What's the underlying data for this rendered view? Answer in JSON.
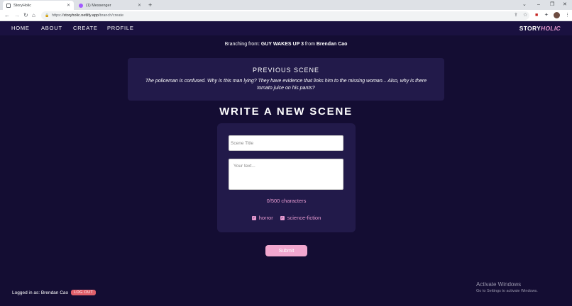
{
  "browser": {
    "tabs": [
      {
        "title": "StoryHolic",
        "active": true,
        "icon": "bookmark-icon"
      },
      {
        "title": "(1) Messenger",
        "active": false,
        "icon": "messenger-icon"
      }
    ],
    "url_protocol": "https://",
    "url_host": "storyholic.netlify.app",
    "url_path": "/branch/create"
  },
  "nav": {
    "items": [
      "HOME",
      "ABOUT",
      "CREATE",
      "PROFILE"
    ],
    "brand_part1": "STORY",
    "brand_part2": "HOLIC"
  },
  "branching": {
    "prefix": "Branching from: ",
    "scene": "GUY WAKES UP 3",
    "mid": " from ",
    "author": "Brendan Cao"
  },
  "previous_scene": {
    "heading": "PREVIOUS SCENE",
    "text": "The policeman is confused. Why is this man lying? They have evidence that links him to the missing woman... Also, why is there tomato juice on his pants?"
  },
  "form": {
    "heading": "WRITE A NEW SCENE",
    "title_placeholder": "Scene Title",
    "text_placeholder": "Your text...",
    "char_count": "0/500 characters",
    "tags": [
      "horror",
      "science-fiction"
    ],
    "submit_label": "Submit"
  },
  "footer": {
    "logged_in_text": "Logged in as: Brendan Cao",
    "logout_label": "LOG OUT"
  },
  "watermark": {
    "line1": "Activate Windows",
    "line2": "Go to Settings to activate Windows."
  },
  "colors": {
    "background": "#140d33",
    "nav": "#1a1140",
    "card": "#221a4a",
    "accent_pink": "#e79ad0",
    "submit": "#f2a7cf",
    "logout": "#e0606b"
  }
}
